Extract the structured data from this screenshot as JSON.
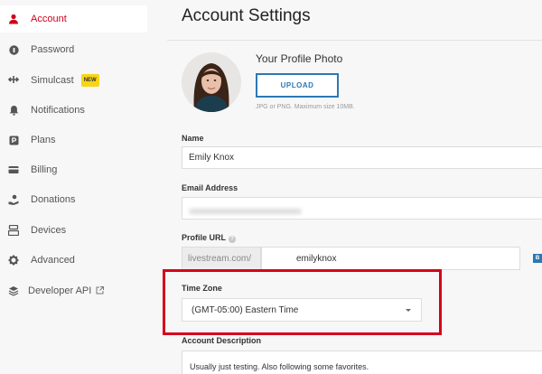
{
  "sidebar": {
    "items": [
      {
        "label": "Account",
        "icon": "user-icon",
        "active": true
      },
      {
        "label": "Password",
        "icon": "lock-icon"
      },
      {
        "label": "Simulcast",
        "icon": "simulcast-icon",
        "badge": "NEW"
      },
      {
        "label": "Notifications",
        "icon": "bell-icon"
      },
      {
        "label": "Plans",
        "icon": "plans-icon"
      },
      {
        "label": "Billing",
        "icon": "credit-card-icon"
      },
      {
        "label": "Donations",
        "icon": "donations-icon"
      },
      {
        "label": "Devices",
        "icon": "devices-icon"
      },
      {
        "label": "Advanced",
        "icon": "gear-icon"
      },
      {
        "label": "Developer API",
        "icon": "layers-icon",
        "external": true
      }
    ]
  },
  "main": {
    "title": "Account Settings",
    "photo": {
      "title": "Your Profile Photo",
      "upload_label": "UPLOAD",
      "hint": "JPG or PNG. Maximum size 10MB."
    },
    "name": {
      "label": "Name",
      "value": "Emily Knox"
    },
    "email": {
      "label": "Email Address"
    },
    "profile_url": {
      "label": "Profile URL",
      "prefix": "livestream.com/",
      "value": "emilyknox",
      "edge_badge": "B"
    },
    "timezone": {
      "label": "Time Zone",
      "value": "(GMT-05:00) Eastern Time"
    },
    "description": {
      "label": "Account Description",
      "value": "Usually just testing. Also following some favorites."
    }
  },
  "colors": {
    "accent": "#d0021b",
    "link_blue": "#2b78b5",
    "highlight": "#d6001c",
    "badge_yellow": "#f8d417"
  }
}
